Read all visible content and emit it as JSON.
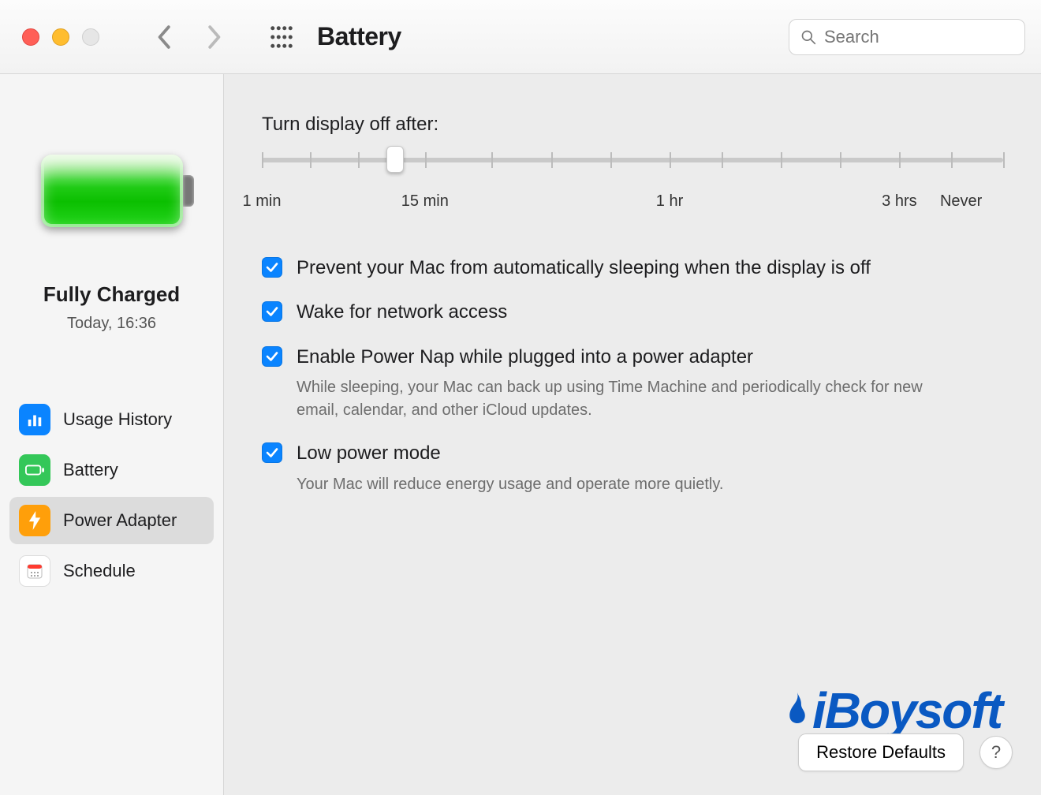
{
  "title": "Battery",
  "search": {
    "placeholder": "Search"
  },
  "battery_status": {
    "line1": "Fully Charged",
    "line2": "Today, 16:36"
  },
  "sidebar": {
    "items": [
      {
        "label": "Usage History"
      },
      {
        "label": "Battery"
      },
      {
        "label": "Power Adapter"
      },
      {
        "label": "Schedule"
      }
    ],
    "selected_index": 2
  },
  "slider": {
    "label": "Turn display off after:",
    "lab_1min": "1 min",
    "lab_15": "15 min",
    "lab_1hr": "1 hr",
    "lab_3hrs": "3 hrs",
    "lab_never": "Never",
    "thumb_percent": 18
  },
  "options": [
    {
      "primary": "Prevent your Mac from automatically sleeping when the display is off",
      "checked": true
    },
    {
      "primary": "Wake for network access",
      "checked": true
    },
    {
      "primary": "Enable Power Nap while plugged into a power adapter",
      "desc": "While sleeping, your Mac can back up using Time Machine and periodically check for new email, calendar, and other iCloud updates.",
      "checked": true
    },
    {
      "primary": "Low power mode",
      "desc": "Your Mac will reduce energy usage and operate more quietly.",
      "checked": true
    }
  ],
  "footer": {
    "restore": "Restore Defaults",
    "help": "?"
  },
  "watermark": "iBoysoft"
}
